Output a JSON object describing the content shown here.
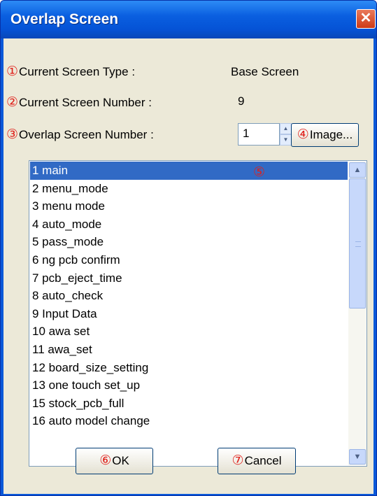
{
  "window": {
    "title": "Overlap Screen",
    "close_symbol": "✕"
  },
  "markers": {
    "m1": "①",
    "m2": "②",
    "m3": "③",
    "m4": "④",
    "m5": "⑤",
    "m6": "⑥",
    "m7": "⑦"
  },
  "fields": {
    "current_type_label": "Current Screen Type :",
    "current_type_value": "Base Screen",
    "current_number_label": "Current Screen Number :",
    "current_number_value": "9",
    "overlap_number_label": "Overlap Screen Number :",
    "overlap_number_value": "1",
    "image_button": "Image..."
  },
  "screens": [
    "1 main",
    "2 menu_mode",
    "3 menu mode",
    "4 auto_mode",
    "5 pass_mode",
    "6 ng pcb confirm",
    "7 pcb_eject_time",
    "8 auto_check",
    "9 Input Data",
    "10 awa set",
    "11 awa_set",
    "12 board_size_setting",
    "13 one touch set_up",
    "15 stock_pcb_full",
    "16 auto model change"
  ],
  "buttons": {
    "ok": "OK",
    "cancel": "Cancel"
  },
  "colors": {
    "selection": "#316ac5",
    "marker_red": "#e0201b",
    "title_blue": "#0a5fe0"
  }
}
